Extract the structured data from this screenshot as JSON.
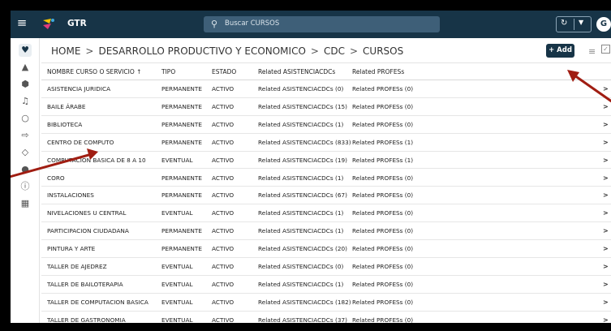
{
  "header": {
    "app_title": "GTR",
    "search_placeholder": "Buscar CURSOS",
    "avatar_initial": "G",
    "brand_colors": {
      "topbar": "#173447",
      "search": "#3e5f78"
    }
  },
  "breadcrumb": {
    "items": [
      "HOME",
      "DESARROLLO PRODUCTIVO Y ECONOMICO",
      "CDC",
      "CURSOS"
    ],
    "separator": ">"
  },
  "toolbar": {
    "add_label": "+ Add"
  },
  "sidebar": {
    "icons": [
      "heart-icon",
      "triangle-icon",
      "hexagon-icon",
      "bell-icon",
      "circle-icon",
      "tag-icon",
      "tag-outline-icon",
      "user-icon",
      "info-icon",
      "grid-icon"
    ]
  },
  "table": {
    "columns": [
      "NOMBRE CURSO O SERVICIO ↑",
      "TIPO",
      "ESTADO",
      "Related ASISTENCIACDCs",
      "Related PROFESs"
    ],
    "rows": [
      [
        "ASISTENCIA JURIDICA",
        "PERMANENTE",
        "ACTIVO",
        "Related ASISTENCIACDCs (0)",
        "Related PROFESs (0)"
      ],
      [
        "BAILE ÁRABE",
        "PERMANENTE",
        "ACTIVO",
        "Related ASISTENCIACDCs (15)",
        "Related PROFESs (0)"
      ],
      [
        "BIBLIOTECA",
        "PERMANENTE",
        "ACTIVO",
        "Related ASISTENCIACDCs (1)",
        "Related PROFESs (0)"
      ],
      [
        "CENTRO DE COMPUTO",
        "PERMANENTE",
        "ACTIVO",
        "Related ASISTENCIACDCs (833)",
        "Related PROFESs (1)"
      ],
      [
        "COMPUTACION BASICA DE 8 A 10",
        "EVENTUAL",
        "ACTIVO",
        "Related ASISTENCIACDCs (19)",
        "Related PROFESs (1)"
      ],
      [
        "CORO",
        "PERMANENTE",
        "ACTIVO",
        "Related ASISTENCIACDCs (1)",
        "Related PROFESs (0)"
      ],
      [
        "INSTALACIONES",
        "PERMANENTE",
        "ACTIVO",
        "Related ASISTENCIACDCs (67)",
        "Related PROFESs (0)"
      ],
      [
        "NIVELACIONES U CENTRAL",
        "EVENTUAL",
        "ACTIVO",
        "Related ASISTENCIACDCs (1)",
        "Related PROFESs (0)"
      ],
      [
        "PARTICIPACION CIUDADANA",
        "PERMANENTE",
        "ACTIVO",
        "Related ASISTENCIACDCs (1)",
        "Related PROFESs (0)"
      ],
      [
        "PINTURA Y ARTE",
        "PERMANENTE",
        "ACTIVO",
        "Related ASISTENCIACDCs (20)",
        "Related PROFESs (0)"
      ],
      [
        "TALLER DE AJEDREZ",
        "EVENTUAL",
        "ACTIVO",
        "Related ASISTENCIACDCs (0)",
        "Related PROFESs (0)"
      ],
      [
        "TALLER DE BAILOTERAPIA",
        "EVENTUAL",
        "ACTIVO",
        "Related ASISTENCIACDCs (1)",
        "Related PROFESs (0)"
      ],
      [
        "TALLER DE COMPUTACION BASICA",
        "EVENTUAL",
        "ACTIVO",
        "Related ASISTENCIACDCs (182)",
        "Related PROFESs (0)"
      ],
      [
        "TALLER DE GASTRONOMIA",
        "EVENTUAL",
        "ACTIVO",
        "Related ASISTENCIACDCs (37)",
        "Related PROFESs (0)"
      ]
    ],
    "row_chevron": ">"
  },
  "annotation_color": "#a01d12"
}
